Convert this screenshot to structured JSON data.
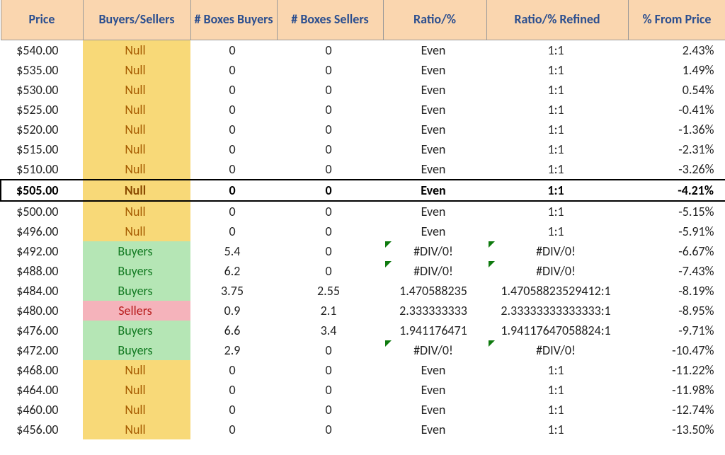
{
  "headers": {
    "price": "Price",
    "bs": "Buyers/Sellers",
    "boxb": "# Boxes Buyers",
    "boxs": "# Boxes Sellers",
    "ratio": "Ratio/%",
    "ratio_ref": "Ratio/% Refined",
    "from_price": "% From Price"
  },
  "rows": [
    {
      "price": "$540.00",
      "bs": "Null",
      "bsCls": "null",
      "boxb": "0",
      "boxs": "0",
      "ratio": "Even",
      "ratio_ref": "1:1",
      "pct": "2.43%",
      "hl": false
    },
    {
      "price": "$535.00",
      "bs": "Null",
      "bsCls": "null",
      "boxb": "0",
      "boxs": "0",
      "ratio": "Even",
      "ratio_ref": "1:1",
      "pct": "1.49%",
      "hl": false
    },
    {
      "price": "$530.00",
      "bs": "Null",
      "bsCls": "null",
      "boxb": "0",
      "boxs": "0",
      "ratio": "Even",
      "ratio_ref": "1:1",
      "pct": "0.54%",
      "hl": false
    },
    {
      "price": "$525.00",
      "bs": "Null",
      "bsCls": "null",
      "boxb": "0",
      "boxs": "0",
      "ratio": "Even",
      "ratio_ref": "1:1",
      "pct": "-0.41%",
      "hl": false
    },
    {
      "price": "$520.00",
      "bs": "Null",
      "bsCls": "null",
      "boxb": "0",
      "boxs": "0",
      "ratio": "Even",
      "ratio_ref": "1:1",
      "pct": "-1.36%",
      "hl": false
    },
    {
      "price": "$515.00",
      "bs": "Null",
      "bsCls": "null",
      "boxb": "0",
      "boxs": "0",
      "ratio": "Even",
      "ratio_ref": "1:1",
      "pct": "-2.31%",
      "hl": false
    },
    {
      "price": "$510.00",
      "bs": "Null",
      "bsCls": "null",
      "boxb": "0",
      "boxs": "0",
      "ratio": "Even",
      "ratio_ref": "1:1",
      "pct": "-3.26%",
      "hl": false
    },
    {
      "price": "$505.00",
      "bs": "Null",
      "bsCls": "null",
      "boxb": "0",
      "boxs": "0",
      "ratio": "Even",
      "ratio_ref": "1:1",
      "pct": "-4.21%",
      "hl": true
    },
    {
      "price": "$500.00",
      "bs": "Null",
      "bsCls": "null",
      "boxb": "0",
      "boxs": "0",
      "ratio": "Even",
      "ratio_ref": "1:1",
      "pct": "-5.15%",
      "hl": false
    },
    {
      "price": "$496.00",
      "bs": "Null",
      "bsCls": "null",
      "boxb": "0",
      "boxs": "0",
      "ratio": "Even",
      "ratio_ref": "1:1",
      "pct": "-5.91%",
      "hl": false
    },
    {
      "price": "$492.00",
      "bs": "Buyers",
      "bsCls": "buyers",
      "boxb": "5.4",
      "boxs": "0",
      "ratio": "#DIV/0!",
      "ratio_err": true,
      "ratio_ref": "#DIV/0!",
      "ratio_ref_err": true,
      "pct": "-6.67%",
      "hl": false
    },
    {
      "price": "$488.00",
      "bs": "Buyers",
      "bsCls": "buyers",
      "boxb": "6.2",
      "boxs": "0",
      "ratio": "#DIV/0!",
      "ratio_err": true,
      "ratio_ref": "#DIV/0!",
      "ratio_ref_err": true,
      "pct": "-7.43%",
      "hl": false
    },
    {
      "price": "$484.00",
      "bs": "Buyers",
      "bsCls": "buyers",
      "boxb": "3.75",
      "boxs": "2.55",
      "ratio": "1.470588235",
      "ratio_ref": "1.47058823529412:1",
      "pct": "-8.19%",
      "hl": false
    },
    {
      "price": "$480.00",
      "bs": "Sellers",
      "bsCls": "sellers",
      "boxb": "0.9",
      "boxs": "2.1",
      "ratio": "2.333333333",
      "ratio_ref": "2.33333333333333:1",
      "pct": "-8.95%",
      "hl": false
    },
    {
      "price": "$476.00",
      "bs": "Buyers",
      "bsCls": "buyers",
      "boxb": "6.6",
      "boxs": "3.4",
      "ratio": "1.941176471",
      "ratio_ref": "1.94117647058824:1",
      "pct": "-9.71%",
      "hl": false
    },
    {
      "price": "$472.00",
      "bs": "Buyers",
      "bsCls": "buyers",
      "boxb": "2.9",
      "boxs": "0",
      "ratio": "#DIV/0!",
      "ratio_err": true,
      "ratio_ref": "#DIV/0!",
      "ratio_ref_err": true,
      "pct": "-10.47%",
      "hl": false
    },
    {
      "price": "$468.00",
      "bs": "Null",
      "bsCls": "null",
      "boxb": "0",
      "boxs": "0",
      "ratio": "Even",
      "ratio_ref": "1:1",
      "pct": "-11.22%",
      "hl": false
    },
    {
      "price": "$464.00",
      "bs": "Null",
      "bsCls": "null",
      "boxb": "0",
      "boxs": "0",
      "ratio": "Even",
      "ratio_ref": "1:1",
      "pct": "-11.98%",
      "hl": false
    },
    {
      "price": "$460.00",
      "bs": "Null",
      "bsCls": "null",
      "boxb": "0",
      "boxs": "0",
      "ratio": "Even",
      "ratio_ref": "1:1",
      "pct": "-12.74%",
      "hl": false
    },
    {
      "price": "$456.00",
      "bs": "Null",
      "bsCls": "null",
      "boxb": "0",
      "boxs": "0",
      "ratio": "Even",
      "ratio_ref": "1:1",
      "pct": "-13.50%",
      "hl": false
    }
  ]
}
